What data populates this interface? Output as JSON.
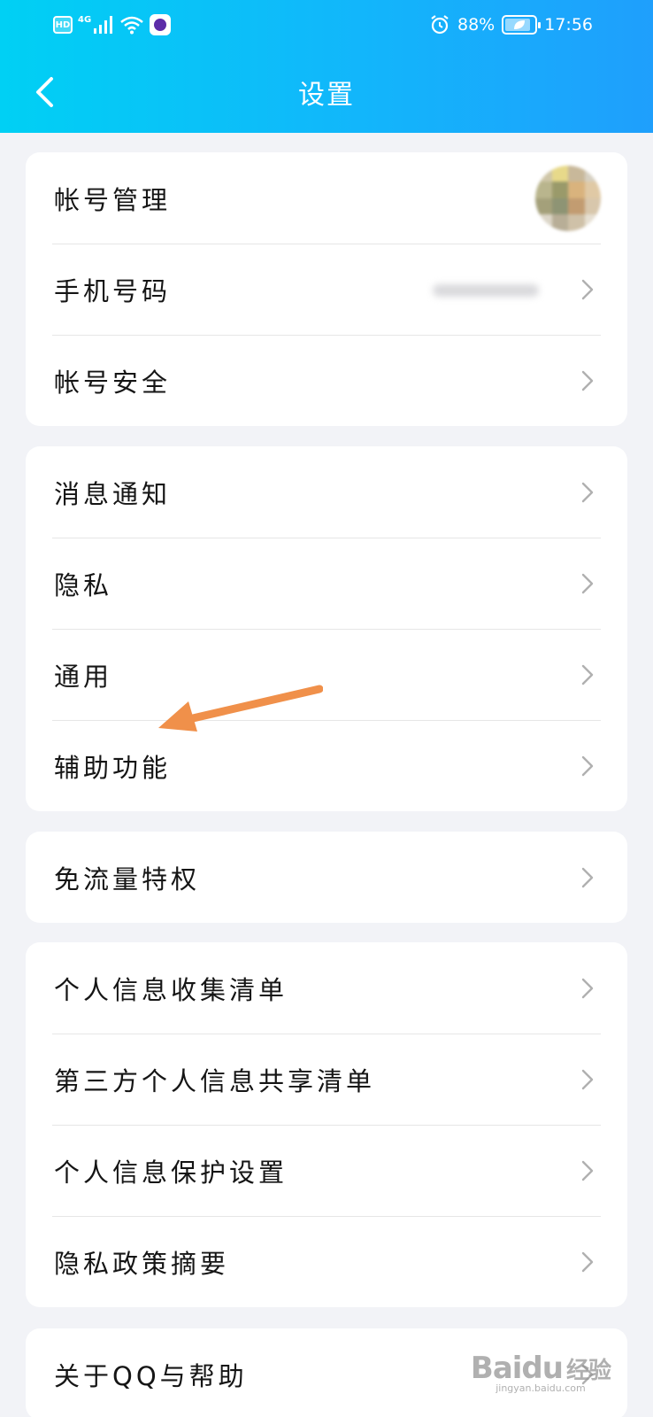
{
  "status_bar": {
    "hd": "HD",
    "network": "4G",
    "battery": "88%",
    "battery_level": 0.88,
    "time": "17:56",
    "icons": [
      "hd-icon",
      "signal-icon",
      "wifi-icon",
      "app-notification-icon",
      "alarm-icon",
      "battery-icon"
    ]
  },
  "header": {
    "title": "设置",
    "back_icon": "chevron-left-icon",
    "background_colors": [
      "#00d0f4",
      "#1f9ffc"
    ]
  },
  "groups": [
    {
      "items": [
        {
          "label": "帐号管理",
          "trailing": "avatar"
        },
        {
          "label": "手机号码",
          "trailing": "chevron-right-icon",
          "value_blurred": true
        },
        {
          "label": "帐号安全",
          "trailing": "chevron-right-icon"
        }
      ]
    },
    {
      "items": [
        {
          "label": "消息通知",
          "trailing": "chevron-right-icon"
        },
        {
          "label": "隐私",
          "trailing": "chevron-right-icon"
        },
        {
          "label": "通用",
          "trailing": "chevron-right-icon"
        },
        {
          "label": "辅助功能",
          "trailing": "chevron-right-icon",
          "highlighted_by_arrow": true
        }
      ]
    },
    {
      "items": [
        {
          "label": "免流量特权",
          "trailing": "chevron-right-icon"
        }
      ]
    },
    {
      "items": [
        {
          "label": "个人信息收集清单",
          "trailing": "chevron-right-icon"
        },
        {
          "label": "第三方个人信息共享清单",
          "trailing": "chevron-right-icon"
        },
        {
          "label": "个人信息保护设置",
          "trailing": "chevron-right-icon"
        },
        {
          "label": "隐私政策摘要",
          "trailing": "chevron-right-icon"
        }
      ]
    },
    {
      "items": [
        {
          "label": "关于QQ与帮助",
          "trailing": "chevron-right-icon"
        }
      ]
    }
  ],
  "annotation": {
    "icon": "orange-arrow-icon",
    "color": "#f0904a"
  },
  "watermark": {
    "logo": "Baidu",
    "suffix": "经验",
    "url": "jingyan.baidu.com"
  },
  "colors": {
    "page_background": "#f2f3f7",
    "card_background": "#ffffff",
    "chevron": "#b0b0b0"
  }
}
